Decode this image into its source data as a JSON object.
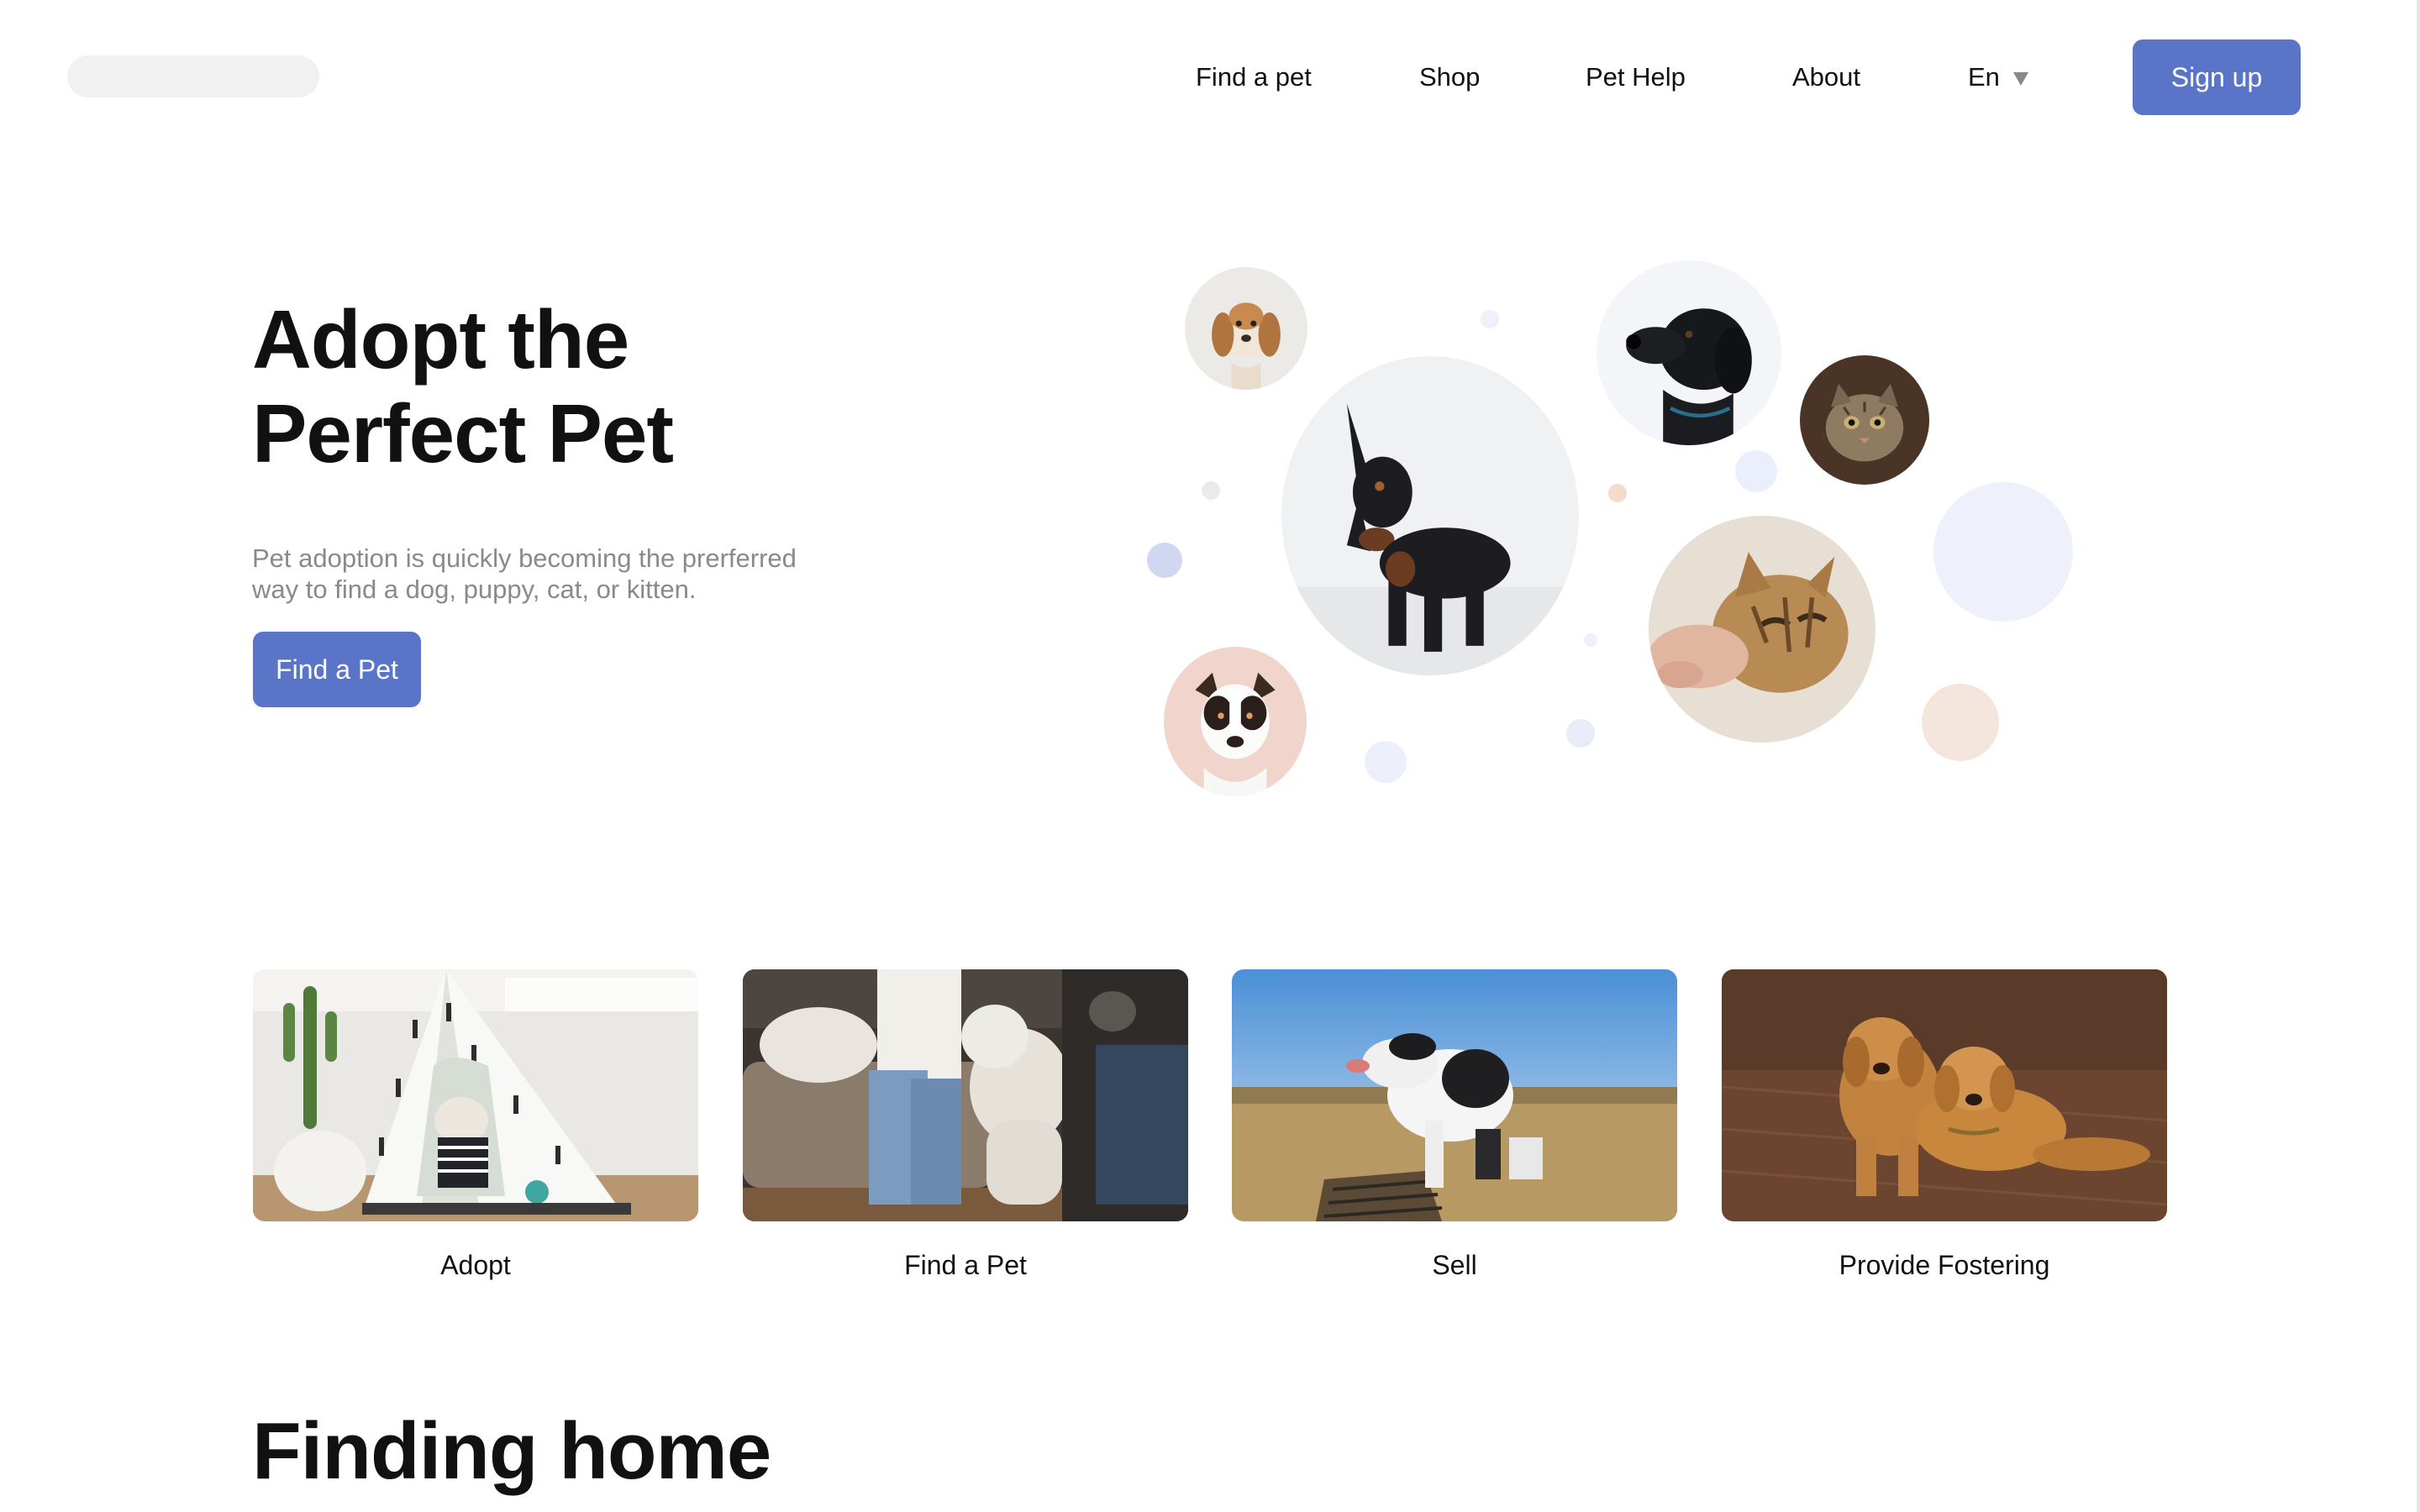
{
  "header": {
    "nav": [
      {
        "label": "Find a pet"
      },
      {
        "label": "Shop"
      },
      {
        "label": "Pet Help"
      },
      {
        "label": "About"
      }
    ],
    "language": "En",
    "signup_label": "Sign up"
  },
  "hero": {
    "title_line1": "Adopt the",
    "title_line2": "Perfect Pet",
    "subtitle_line1": "Pet adoption is quickly becoming the prerferred",
    "subtitle_line2": "way to find a dog, puppy, cat, or kitten.",
    "cta_label": "Find a Pet"
  },
  "cards": [
    {
      "label": "Adopt"
    },
    {
      "label": "Find a Pet"
    },
    {
      "label": "Sell"
    },
    {
      "label": "Provide Fostering"
    }
  ],
  "section": {
    "title": "Finding home"
  },
  "colors": {
    "accent": "#5a74c8",
    "subtitle_text": "#8a8a8a",
    "logo_placeholder": "#f1f1f1"
  }
}
